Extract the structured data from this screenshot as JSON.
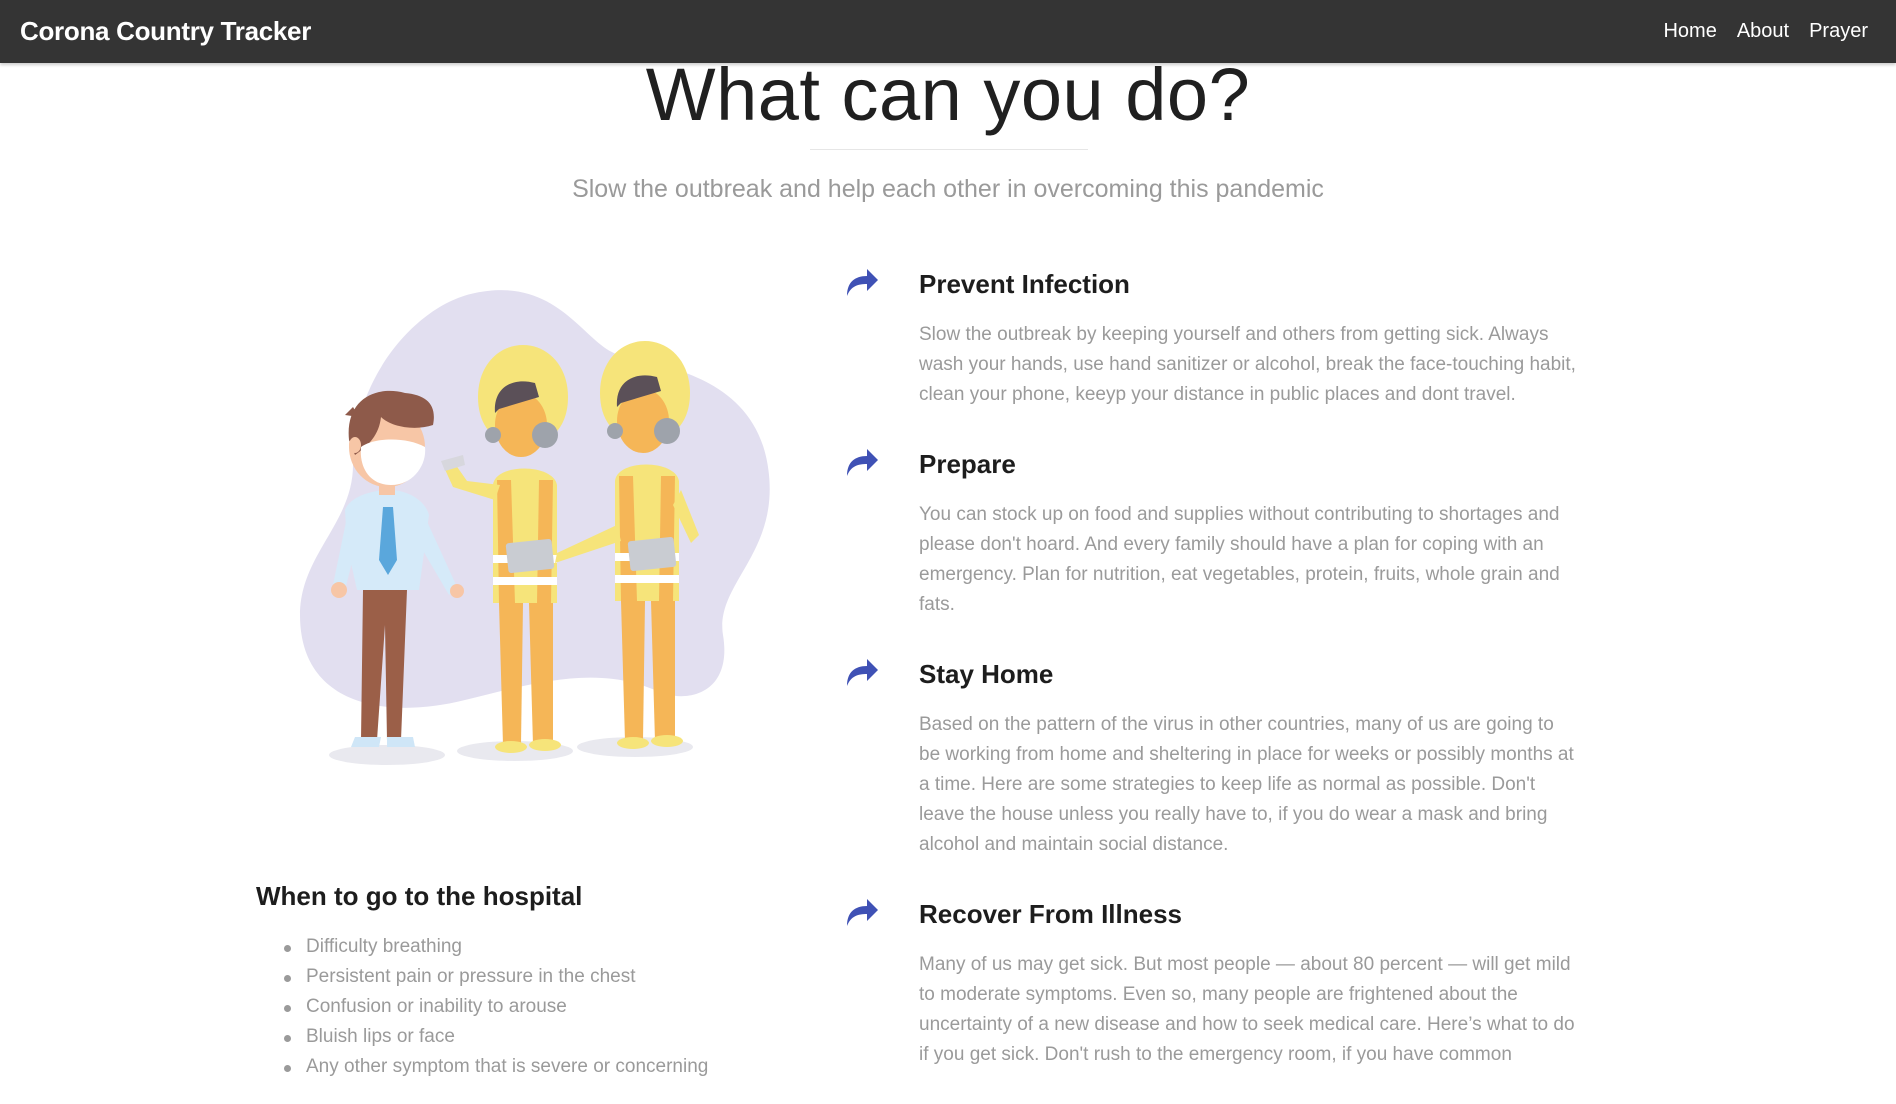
{
  "navbar": {
    "brand": "Corona Country Tracker",
    "links": [
      {
        "label": "Home"
      },
      {
        "label": "About"
      },
      {
        "label": "Prayer"
      }
    ]
  },
  "hero": {
    "title": "What can you do?",
    "subtitle": "Slow the outbreak and help each other in overcoming this pandemic"
  },
  "tips": [
    {
      "icon": "share-arrow-icon",
      "title": "Prevent Infection",
      "text": "Slow the outbreak by keeping yourself and others from getting sick. Always wash your hands, use hand sanitizer or alcohol, break the face-touching habit, clean your phone, keeyp your distance in public places and dont travel."
    },
    {
      "icon": "share-arrow-icon",
      "title": "Prepare",
      "text": "You can stock up on food and supplies without contributing to shortages and please don't hoard. And every family should have a plan for coping with an emergency. Plan for nutrition, eat vegetables, protein, fruits, whole grain and fats."
    },
    {
      "icon": "share-arrow-icon",
      "title": "Stay Home",
      "text": "Based on the pattern of the virus in other countries, many of us are going to be working from home and sheltering in place for weeks or possibly months at a time. Here are some strategies to keep life as normal as possible. Don't leave the house unless you really have to, if you do wear a mask and bring alcohol and maintain social distance."
    },
    {
      "icon": "share-arrow-icon",
      "title": "Recover From Illness",
      "text": "Many of us may get sick. But most people — about 80 percent — will get mild to moderate symptoms. Even so, many people are frightened about the uncertainty of a new disease and how to seek medical care. Here’s what to do if you get sick. Don't rush to the emergency room, if you have common"
    }
  ],
  "hospital": {
    "title": "When to go to the hospital",
    "items": [
      "Difficulty breathing",
      "Persistent pain or pressure in the chest",
      "Confusion or inability to arouse",
      "Bluish lips or face",
      "Any other symptom that is severe or concerning"
    ]
  },
  "colors": {
    "navbar": "#343434",
    "accent": "#3f51b5",
    "muted_text": "#9a9a9a",
    "blob": "#e2dff0",
    "vest": "#f5b657",
    "suit": "#f6e47a"
  }
}
